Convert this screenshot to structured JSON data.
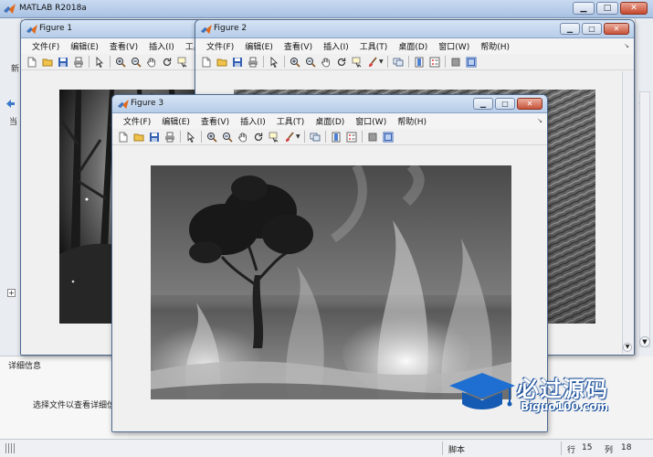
{
  "main_window": {
    "title": "MATLAB R2018a",
    "controls": {
      "minimize": "▁",
      "maximize": "□",
      "close": "✕"
    },
    "left_fragment_1": "新",
    "left_fragment_2": "当",
    "details_title": "详细信息",
    "details_text": "选择文件以查看详细信",
    "tree_expander": "+"
  },
  "statusbar": {
    "mode": "脚本",
    "row_label": "行",
    "row_value": "15",
    "col_label": "列",
    "col_value": "18"
  },
  "figures": [
    {
      "title": "Figure 1",
      "menus": [
        "文件(F)",
        "编辑(E)",
        "查看(V)",
        "插入(I)",
        "工具("
      ],
      "controls": {
        "minimize": "▁",
        "maximize": "□",
        "close": "✕"
      }
    },
    {
      "title": "Figure 2",
      "menus": [
        "文件(F)",
        "编辑(E)",
        "查看(V)",
        "插入(I)",
        "工具(T)",
        "桌面(D)",
        "窗口(W)",
        "帮助(H)"
      ],
      "controls": {
        "minimize": "▁",
        "maximize": "□",
        "close": "✕"
      }
    },
    {
      "title": "Figure 3",
      "menus": [
        "文件(F)",
        "编辑(E)",
        "查看(V)",
        "插入(I)",
        "工具(T)",
        "桌面(D)",
        "窗口(W)",
        "帮助(H)"
      ],
      "controls": {
        "minimize": "▁",
        "maximize": "□",
        "close": "✕"
      }
    }
  ],
  "toolbar_icons": [
    "new-file-icon",
    "open-folder-icon",
    "save-icon",
    "print-icon",
    "pointer-icon",
    "zoom-in-icon",
    "zoom-out-icon",
    "pan-icon",
    "rotate-icon",
    "data-cursor-icon",
    "brush-icon",
    "link-plot-icon",
    "colorbar-icon",
    "legend-icon",
    "hide-plot-tools-icon",
    "show-plot-tools-icon"
  ],
  "watermark": {
    "title": "必过源码",
    "subtitle": "Biguo100.com"
  }
}
